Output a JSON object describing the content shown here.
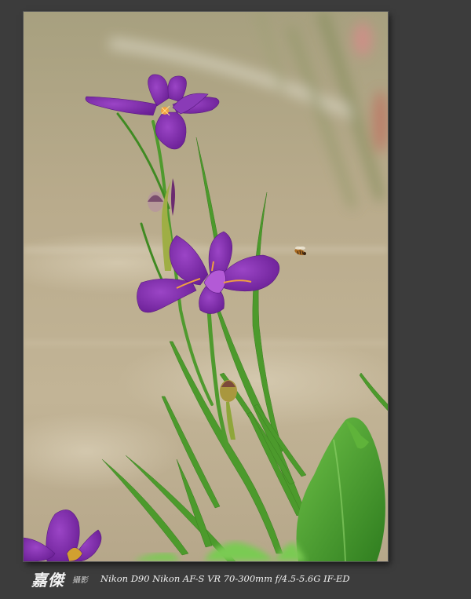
{
  "photo": {
    "subject": "",
    "colors": {
      "background": "#3c3c3c",
      "water": "#b7a888",
      "petal": "#7a2aa8",
      "leaf": "#3f8f2a"
    }
  },
  "caption": {
    "signature": "嘉傑",
    "signature_sub": "攝影",
    "exif": "Nikon D90  Nikon AF-S VR 70-300mm f/4.5-5.6G IF-ED"
  }
}
